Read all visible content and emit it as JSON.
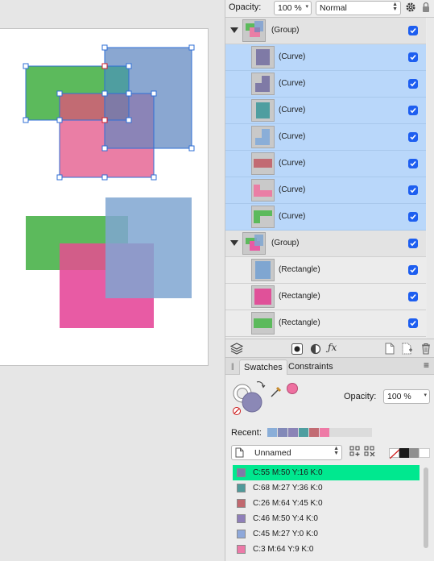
{
  "toolbar": {
    "opacity_label": "Opacity:",
    "opacity_value": "100 %",
    "blend_mode": "Normal"
  },
  "layers": [
    {
      "kind": "group",
      "name": "(Group)",
      "visible": true,
      "selected": false
    },
    {
      "kind": "child",
      "name": "(Curve)",
      "visible": true,
      "selected": true,
      "thumb_color": "#7f7aa6"
    },
    {
      "kind": "child",
      "name": "(Curve)",
      "visible": true,
      "selected": true,
      "thumb_color": "#7f7aa6"
    },
    {
      "kind": "child",
      "name": "(Curve)",
      "visible": true,
      "selected": true,
      "thumb_color": "#4f9ea0"
    },
    {
      "kind": "child",
      "name": "(Curve)",
      "visible": true,
      "selected": true,
      "thumb_color": "#8aaed8"
    },
    {
      "kind": "child",
      "name": "(Curve)",
      "visible": true,
      "selected": true,
      "thumb_color": "#c26b73"
    },
    {
      "kind": "child",
      "name": "(Curve)",
      "visible": true,
      "selected": true,
      "thumb_color": "#ea7ea5"
    },
    {
      "kind": "child",
      "name": "(Curve)",
      "visible": true,
      "selected": true,
      "thumb_color": "#5cba5c"
    },
    {
      "kind": "group",
      "name": "(Group)",
      "visible": true,
      "selected": false
    },
    {
      "kind": "child",
      "name": "(Rectangle)",
      "visible": true,
      "selected": false,
      "thumb_color": "#8aaed8"
    },
    {
      "kind": "child",
      "name": "(Rectangle)",
      "visible": true,
      "selected": false,
      "thumb_color": "#e85ba4"
    },
    {
      "kind": "child",
      "name": "(Rectangle)",
      "visible": true,
      "selected": false,
      "thumb_color": "#5cba5c"
    }
  ],
  "tabs": {
    "swatches": "Swatches",
    "constraints": "Constraints"
  },
  "swatch_panel": {
    "opacity_label": "Opacity:",
    "opacity_value": "100 %",
    "fill_color": "#8b88b6",
    "eyedropper_color": "#ee70a0"
  },
  "recent": {
    "label": "Recent:",
    "colors": [
      "#8aaed8",
      "#8289b8",
      "#8b84b7",
      "#4f9ea0",
      "#c26b73",
      "#ee7aa6"
    ]
  },
  "palette": {
    "name": "Unnamed"
  },
  "swatches": [
    {
      "label": "C:55 M:50 Y:16 K:0",
      "color": "#7d7aa8",
      "active": true
    },
    {
      "label": "C:68 M:27 Y:36 K:0",
      "color": "#4f9a9a",
      "active": false
    },
    {
      "label": "C:26 M:64 Y:45 K:0",
      "color": "#c1686f",
      "active": false
    },
    {
      "label": "C:46 M:50 Y:4 K:0",
      "color": "#8f7fb9",
      "active": false
    },
    {
      "label": "C:45 M:27 Y:0 K:0",
      "color": "#8ea8da",
      "active": false
    },
    {
      "label": "C:3 M:64 Y:9 K:0",
      "color": "#ec7aa8",
      "active": false
    }
  ],
  "colors": {
    "selection_row": "#b9d7fa",
    "checkbox": "#1d5ef0",
    "active_swatch": "#00e88f"
  }
}
